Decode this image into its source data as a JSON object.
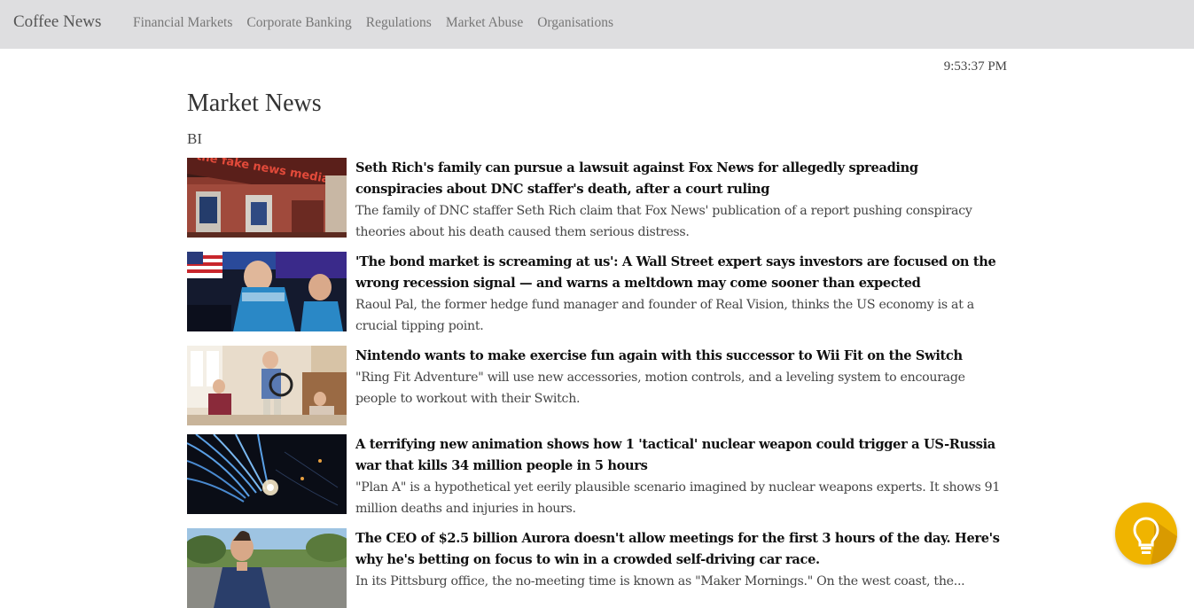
{
  "navbar": {
    "brand": "Coffee News",
    "links": [
      "Financial Markets",
      "Corporate Banking",
      "Regulations",
      "Market Abuse",
      "Organisations"
    ]
  },
  "clock": "9:53:37 PM",
  "page_title": "Market News",
  "source": "BI",
  "articles": [
    {
      "headline": "Seth Rich's family can pursue a lawsuit against Fox News for allegedly spreading conspiracies about DNC staffer's death, after a court ruling",
      "summary": "The family of DNC staffer Seth Rich claim that Fox News' publication of a report pushing conspiracy theories about his death caused them serious distress.",
      "image_text": "the fake news media"
    },
    {
      "headline": "'The bond market is screaming at us': A Wall Street expert says investors are focused on the wrong recession signal — and warns a meltdown may come sooner than expected",
      "summary": "Raoul Pal, the former hedge fund manager and founder of Real Vision, thinks the US economy is at a crucial tipping point."
    },
    {
      "headline": "Nintendo wants to make exercise fun again with this successor to Wii Fit on the Switch",
      "summary": "\"Ring Fit Adventure\" will use new accessories, motion controls, and a leveling system to encourage people to workout with their Switch."
    },
    {
      "headline": "A terrifying new animation shows how 1 'tactical' nuclear weapon could trigger a US-Russia war that kills 34 million people in 5 hours",
      "summary": "\"Plan A\" is a hypothetical yet eerily plausible scenario imagined by nuclear weapons experts. It shows 91 million deaths and injuries in hours."
    },
    {
      "headline": "The CEO of $2.5 billion Aurora doesn't allow meetings for the first 3 hours of the day. Here's why he's betting on focus to win in a crowded self-driving car race.",
      "summary": "In its Pittsburg office, the no-meeting time is known as \"Maker Mornings.\" On the west coast, the..."
    }
  ],
  "fab_icon": "lightbulb-icon",
  "colors": {
    "navbar_bg": "#dedee0",
    "fab": "#f0b400"
  }
}
